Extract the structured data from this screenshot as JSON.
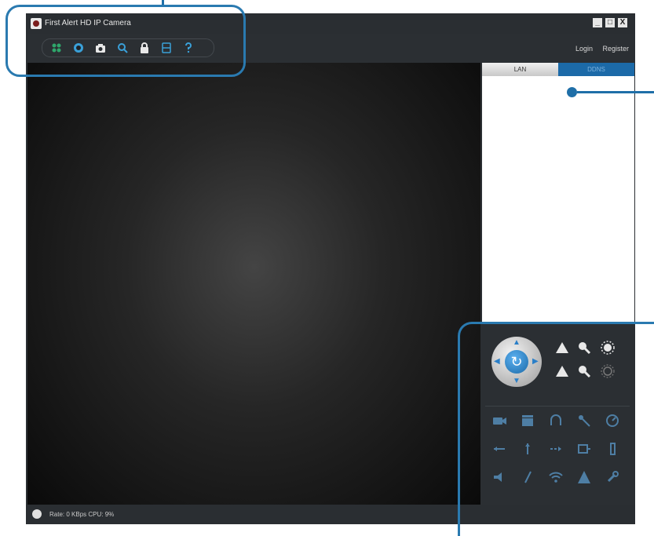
{
  "window": {
    "title": "First Alert HD IP Camera",
    "controls": [
      "_",
      "□",
      "X"
    ]
  },
  "toolbar": {
    "icons": [
      "multi-view-icon",
      "camera-icon",
      "snapshot-icon",
      "search-icon",
      "lock-icon",
      "record-icon",
      "help-icon"
    ]
  },
  "header": {
    "login": "Login",
    "register": "Register"
  },
  "tabs": {
    "lan": "LAN",
    "ddns": "DDNS"
  },
  "status": {
    "text": "Rate: 0 KBps  CPU:  9%"
  },
  "colors": {
    "accent": "#1c6aa8",
    "callout": "#2a7ab0",
    "chrome": "#2b2f33"
  }
}
